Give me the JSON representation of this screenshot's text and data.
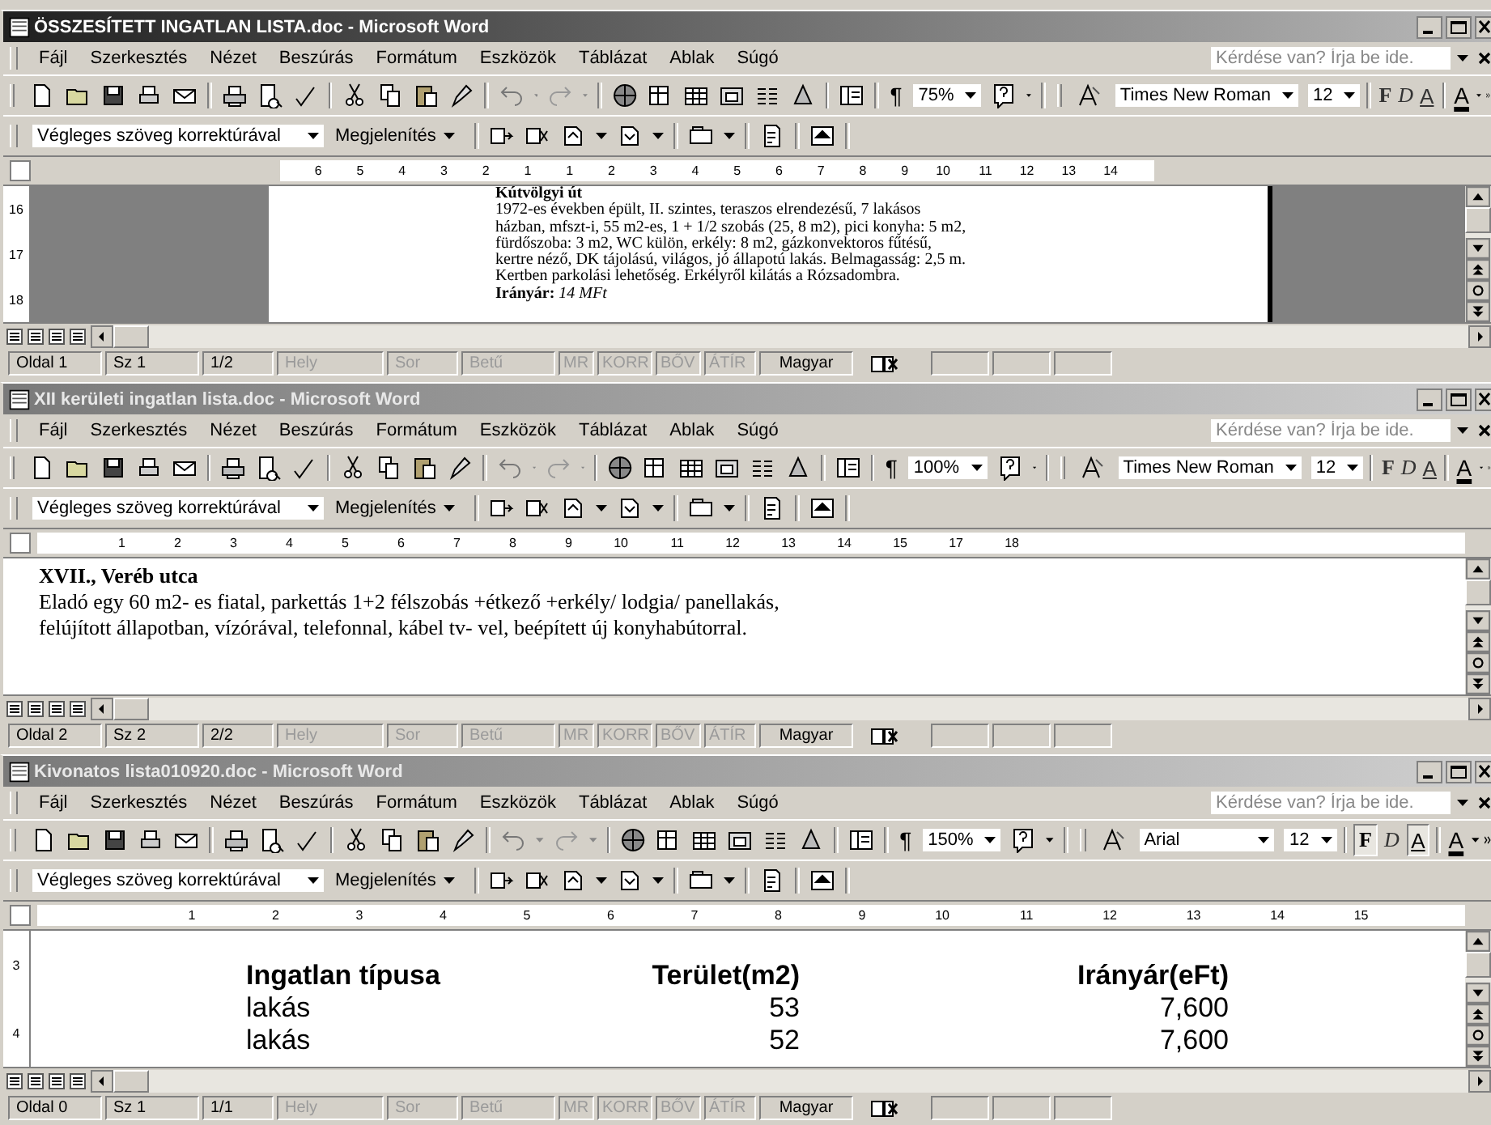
{
  "windows": [
    {
      "title": "ÖSSZESÍTETT INGATLAN LISTA.doc - Microsoft Word",
      "active": true,
      "menu": [
        "Fájl",
        "Szerkesztés",
        "Nézet",
        "Beszúrás",
        "Formátum",
        "Eszközök",
        "Táblázat",
        "Ablak",
        "Súgó"
      ],
      "help_placeholder": "Kérdése van? Írja be ide.",
      "pilcrow": "¶",
      "zoom": "75%",
      "font": "Times New Roman",
      "font_size": "12",
      "format_buttons": [
        {
          "label": "F",
          "pressed": false
        },
        {
          "label": "D",
          "pressed": false
        },
        {
          "label": "A",
          "pressed": false
        }
      ],
      "font_color_label": "A",
      "review_mode": "Végleges szöveg korrektúrával",
      "show_menu": "Megjelenítés",
      "ruler": [
        "6",
        "5",
        "4",
        "3",
        "2",
        "1",
        "1",
        "2",
        "3",
        "4",
        "5",
        "6",
        "7",
        "8",
        "9",
        "10",
        "11",
        "12",
        "13",
        "14"
      ],
      "vertical_ruler": [
        "16",
        "17",
        "18"
      ],
      "document": {
        "kind": "print",
        "heading": "Kútvölgyi út",
        "lines": [
          "1972-es években épült, II. szintes, teraszos elrendezésű, 7 lakásos",
          "házban, mfszt-i, 55 m2-es, 1 + 1/2 szobás (25, 8 m2), pici konyha: 5 m2,",
          "fürdőszoba: 3 m2, WC külön, erkély: 8 m2, gázkonvektoros fűtésű,",
          "kertre néző, DK tájolású, világos, jó állapotú lakás. Belmagasság: 2,5 m.",
          "Kertben parkolási lehetőség. Erkélyről kilátás a Rózsadombra."
        ],
        "price": "**Irányár:** *14 MFt*"
      },
      "status": [
        {
          "text": "Oldal 1",
          "disabled": false
        },
        {
          "text": "Sz 1",
          "disabled": false
        },
        {
          "text": "1/2",
          "disabled": false
        },
        {
          "text": "Hely",
          "disabled": true
        },
        {
          "text": "Sor",
          "disabled": true
        },
        {
          "text": "Betű",
          "disabled": true
        },
        {
          "text": "MR",
          "disabled": true
        },
        {
          "text": "KORR",
          "disabled": true
        },
        {
          "text": "BŐV",
          "disabled": true
        },
        {
          "text": "ÁTÍR",
          "disabled": true
        },
        {
          "text": "Magyar",
          "disabled": false
        }
      ]
    },
    {
      "title": "XII kerületi ingatlan lista.doc - Microsoft Word",
      "active": false,
      "menu": [
        "Fájl",
        "Szerkesztés",
        "Nézet",
        "Beszúrás",
        "Formátum",
        "Eszközök",
        "Táblázat",
        "Ablak",
        "Súgó"
      ],
      "help_placeholder": "Kérdése van? Írja be ide.",
      "pilcrow": "¶",
      "zoom": "100%",
      "font": "Times New Roman",
      "font_size": "12",
      "format_buttons": [
        {
          "label": "F",
          "pressed": false
        },
        {
          "label": "D",
          "pressed": false
        },
        {
          "label": "A",
          "pressed": false
        }
      ],
      "font_color_label": "A",
      "review_mode": "Végleges szöveg korrektúrával",
      "show_menu": "Megjelenítés",
      "ruler": [
        "1",
        "2",
        "3",
        "4",
        "5",
        "6",
        "7",
        "8",
        "9",
        "10",
        "11",
        "12",
        "13",
        "14",
        "15",
        "17",
        "18"
      ],
      "document": {
        "kind": "normal",
        "heading": "XVII., Veréb utca",
        "lines": [
          "Eladó egy 60 m2- es fiatal, parkettás 1+2 félszobás +étkező +erkély/ lodgia/ panellakás,",
          "felújított állapotban, vízórával, telefonnal, kábel tv- vel, beépített új konyhabútorral."
        ]
      },
      "status": [
        {
          "text": "Oldal 2",
          "disabled": false
        },
        {
          "text": "Sz 2",
          "disabled": false
        },
        {
          "text": "2/2",
          "disabled": false
        },
        {
          "text": "Hely",
          "disabled": true
        },
        {
          "text": "Sor",
          "disabled": true
        },
        {
          "text": "Betű",
          "disabled": true
        },
        {
          "text": "MR",
          "disabled": true
        },
        {
          "text": "KORR",
          "disabled": true
        },
        {
          "text": "BŐV",
          "disabled": true
        },
        {
          "text": "ÁTÍR",
          "disabled": true
        },
        {
          "text": "Magyar",
          "disabled": false
        }
      ]
    },
    {
      "title": "Kivonatos lista010920.doc - Microsoft Word",
      "active": false,
      "menu": [
        "Fájl",
        "Szerkesztés",
        "Nézet",
        "Beszúrás",
        "Formátum",
        "Eszközök",
        "Táblázat",
        "Ablak",
        "Súgó"
      ],
      "help_placeholder": "Kérdése van? Írja be ide.",
      "pilcrow": "¶",
      "zoom": "150%",
      "font": "Arial",
      "font_size": "12",
      "format_buttons": [
        {
          "label": "F",
          "pressed": true
        },
        {
          "label": "D",
          "pressed": false
        },
        {
          "label": "A",
          "pressed": true
        }
      ],
      "font_color_label": "A",
      "review_mode": "Végleges szöveg korrektúrával",
      "show_menu": "Megjelenítés",
      "ruler": [
        "1",
        "2",
        "3",
        "4",
        "5",
        "6",
        "7",
        "8",
        "9",
        "10",
        "11",
        "12",
        "13",
        "14",
        "15"
      ],
      "vertical_ruler": [
        "3",
        "4"
      ],
      "document": {
        "kind": "table",
        "columns": [
          "Ingatlan típusa",
          "Terület(m2)",
          "Irányár(eFt)"
        ],
        "rows": [
          [
            "lakás",
            "53",
            "7,600"
          ],
          [
            "lakás",
            "52",
            "7,600"
          ]
        ]
      },
      "status": [
        {
          "text": "Oldal 0",
          "disabled": false
        },
        {
          "text": "Sz 1",
          "disabled": false
        },
        {
          "text": "1/1",
          "disabled": false
        },
        {
          "text": "Hely",
          "disabled": true
        },
        {
          "text": "Sor",
          "disabled": true
        },
        {
          "text": "Betű",
          "disabled": true
        },
        {
          "text": "MR",
          "disabled": true
        },
        {
          "text": "KORR",
          "disabled": true
        },
        {
          "text": "BŐV",
          "disabled": true
        },
        {
          "text": "ÁTÍR",
          "disabled": true
        },
        {
          "text": "Magyar",
          "disabled": false
        }
      ]
    }
  ]
}
